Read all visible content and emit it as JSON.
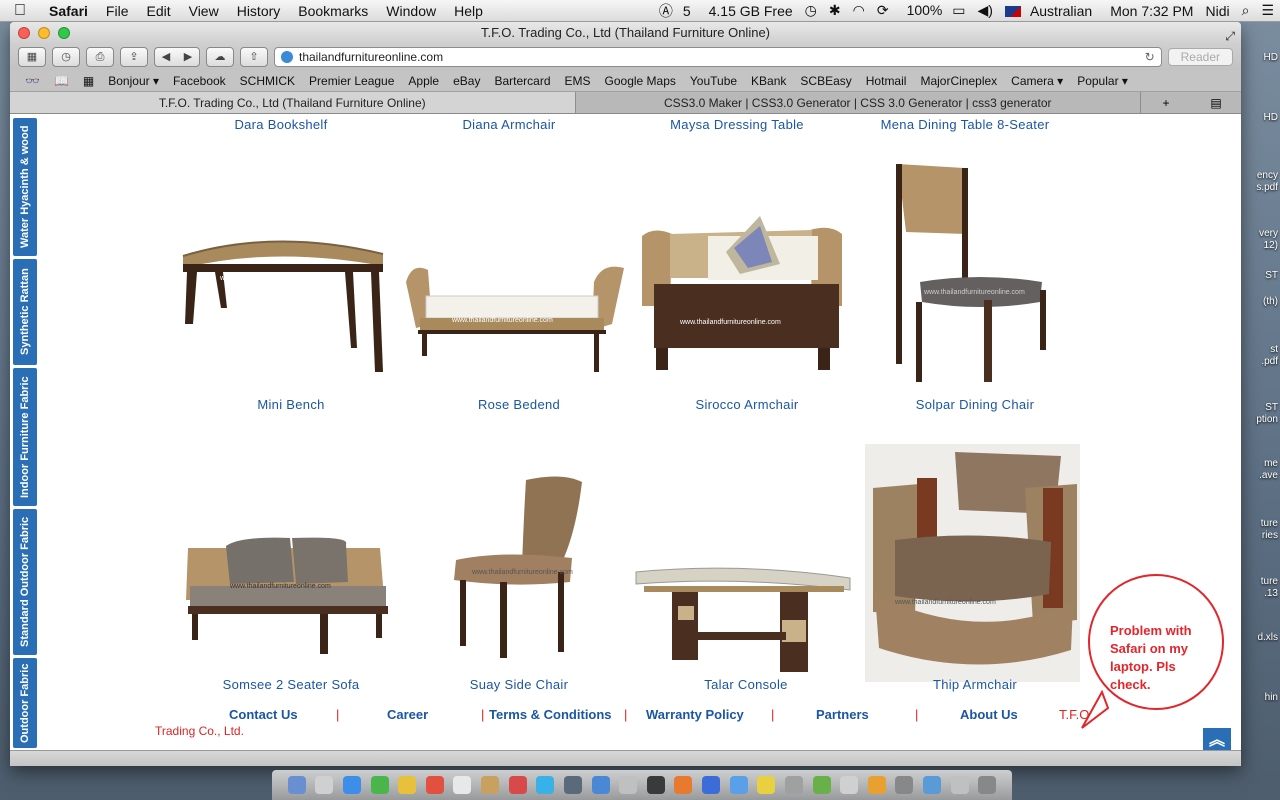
{
  "menubar": {
    "app": "Safari",
    "menus": [
      "File",
      "Edit",
      "View",
      "History",
      "Bookmarks",
      "Window",
      "Help"
    ],
    "status": {
      "adobe": "5",
      "free_space": "4.15 GB Free",
      "battery": "100%",
      "input": "Australian",
      "clock": "Mon 7:32 PM",
      "user": "Nidi"
    }
  },
  "window": {
    "title": "T.F.O. Trading Co., Ltd (Thailand Furniture Online)",
    "url": "thailandfurnitureonline.com",
    "reader_label": "Reader"
  },
  "bookmarks": [
    "Bonjour ▾",
    "Facebook",
    "SCHMICK",
    "Premier League",
    "Apple",
    "eBay",
    "Bartercard",
    "EMS",
    "Google Maps",
    "YouTube",
    "KBank",
    "SCBEasy",
    "Hotmail",
    "MajorCineplex",
    "Camera ▾",
    "Popular ▾"
  ],
  "tabs": [
    {
      "label": "T.F.O. Trading Co., Ltd (Thailand Furniture Online)"
    },
    {
      "label": "CSS3.0 Maker | CSS3.0 Generator | CSS 3.0 Generator | css3 generator"
    }
  ],
  "sidenav": [
    "Water Hyacinth & wood",
    "Synthetic Rattan",
    "Indoor Furniture Fabric",
    "Standard Outdoor Fabric",
    "Outdoor Fabric"
  ],
  "products_top_row": [
    "Dara Bookshelf",
    "Diana Armchair",
    "Maysa Dressing Table",
    "Mena Dining Table 8-Seater"
  ],
  "products_row1": [
    {
      "name": "Mini Bench",
      "watermark": "www.thailandfurnitureonline.com"
    },
    {
      "name": "Rose Bedend",
      "watermark": "www.thailandfurnitureonline.com"
    },
    {
      "name": "Sirocco Armchair",
      "watermark": "www.thailandfurnitureonline.com"
    },
    {
      "name": "Solpar Dining Chair",
      "watermark": "www.thailandfurnitureonline.com"
    }
  ],
  "products_row2": [
    {
      "name": "Somsee 2 Seater Sofa",
      "watermark": "www.thailandfurnitureonline.com"
    },
    {
      "name": "Suay Side Chair",
      "watermark": "www.thailandfurnitureonline.com"
    },
    {
      "name": "Talar Console",
      "watermark": ""
    },
    {
      "name": "Thip Armchair",
      "watermark": "www.thailandfurnitureonline.com"
    }
  ],
  "footer": {
    "links": [
      "Contact Us",
      "Career",
      "Terms & Conditions",
      "Warranty Policy",
      "Partners",
      "About Us"
    ],
    "brand": "T.F.O.",
    "company": "Trading Co., Ltd."
  },
  "bubble": {
    "text": "Problem with Safari on my laptop. Pls check."
  },
  "desktop_icons": [
    "HD",
    "HD",
    "ency",
    "s.pdf",
    "very",
    "12)",
    "ST",
    "(th)",
    "st",
    ".pdf",
    "ST",
    "ption",
    "me",
    ".ave",
    "ture",
    "ries",
    "ture",
    ".13",
    "d.xls",
    "hin"
  ],
  "colors": {
    "link": "#1b56a4",
    "sidenav": "#2a6fb6",
    "footer_sep": "#dd2222",
    "bubble": "#e3262b"
  }
}
